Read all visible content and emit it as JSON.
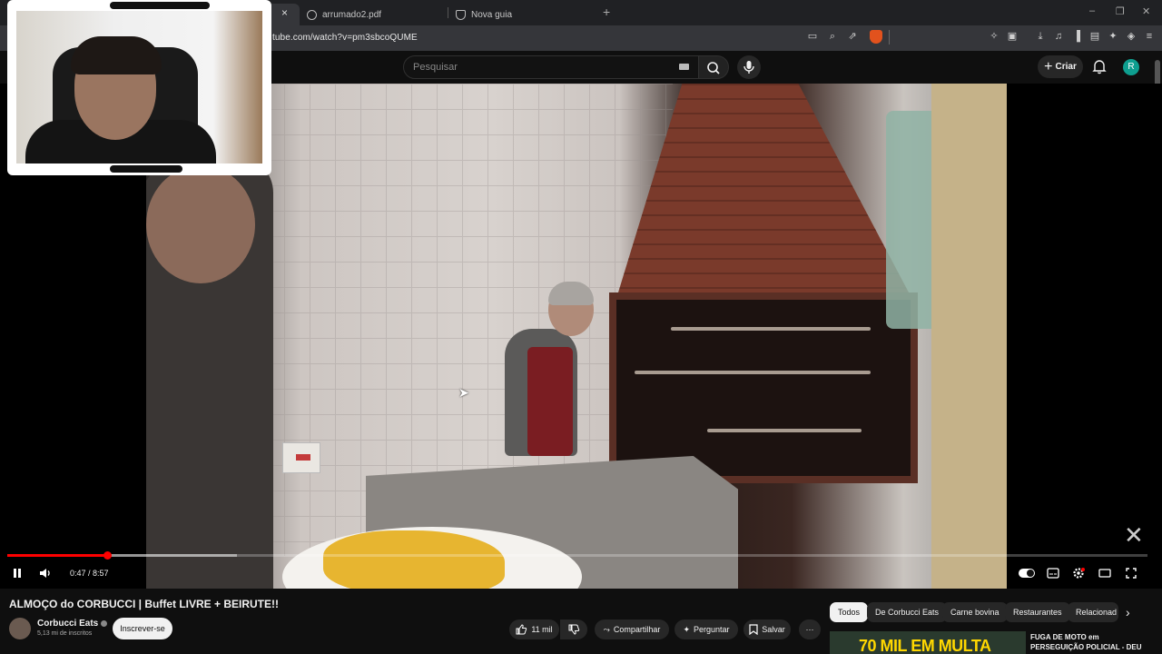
{
  "browser": {
    "tabs": [
      {
        "label": "",
        "active": true
      },
      {
        "label": "arrumado2.pdf",
        "active": false
      },
      {
        "label": "Nova guia",
        "active": false
      }
    ],
    "close_tab": "×",
    "new_tab": "+",
    "url": "tube.com/watch?v=pm3sbcoQUME",
    "window_controls": [
      "–",
      "❐",
      "✕"
    ]
  },
  "youtube": {
    "search_placeholder": "Pesquisar",
    "create_label": "Criar",
    "avatar_letter": "R"
  },
  "player": {
    "current_time": "0:47",
    "duration": "8:57",
    "time_display": "0:47 / 8:57",
    "progress_fraction": 0.0875,
    "buffered_fraction": 0.2,
    "state": "playing"
  },
  "video": {
    "title": "ALMOÇO do CORBUCCI | Buffet LIVRE + BEIRUTE!!",
    "channel_name": "Corbucci Eats",
    "subscribers": "5,13 mi de inscritos",
    "subscribe_label": "Inscrever-se",
    "likes": "11 mil",
    "share_label": "Compartilhar",
    "ask_label": "Perguntar",
    "save_label": "Salvar",
    "more_label": "···"
  },
  "chips": [
    {
      "label": "Todos",
      "selected": true
    },
    {
      "label": "De Corbucci Eats",
      "selected": false
    },
    {
      "label": "Carne bovina",
      "selected": false
    },
    {
      "label": "Restaurantes",
      "selected": false
    },
    {
      "label": "Relacionad",
      "selected": false
    }
  ],
  "related": {
    "thumbnail_text": "70 MIL EM MULTA",
    "title": "FUGA DE MOTO em PERSEGUIÇÃO POLICIAL - DEU"
  },
  "colors": {
    "progress": "#ff0000",
    "avatar": "#0e9e8f",
    "brave_shield": "#e2521d"
  }
}
